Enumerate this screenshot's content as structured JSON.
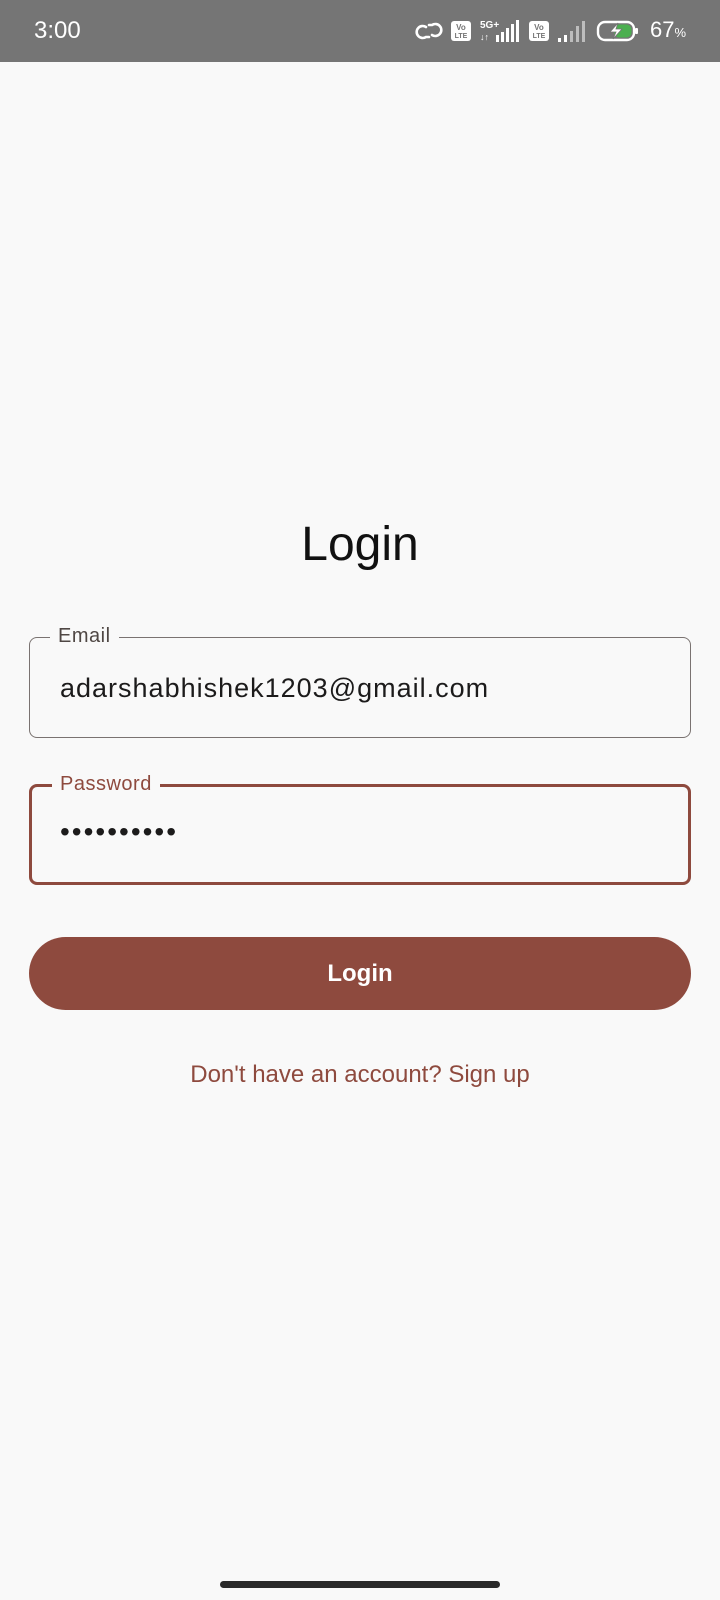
{
  "status_bar": {
    "time": "3:00",
    "battery_percent": "67",
    "battery_percent_sign": "%",
    "icons": [
      "hotspot-link-icon",
      "volte-icon",
      "5g-signal-icon",
      "volte-icon",
      "signal-icon",
      "battery-charging-icon"
    ],
    "sim1_network": "5G+",
    "volte_label_top": "Vo",
    "volte_label_bottom": "LTE"
  },
  "login": {
    "title": "Login",
    "email_label": "Email",
    "email_value": "adarshabhishek1203@gmail.com",
    "password_label": "Password",
    "password_value": "••••••••••",
    "button_label": "Login",
    "signup_text": "Don't have an account? Sign up"
  },
  "colors": {
    "accent": "#8e4a3e",
    "background": "#f9f9f9",
    "status_bar": "#757575",
    "battery_fill": "#4caf50"
  }
}
